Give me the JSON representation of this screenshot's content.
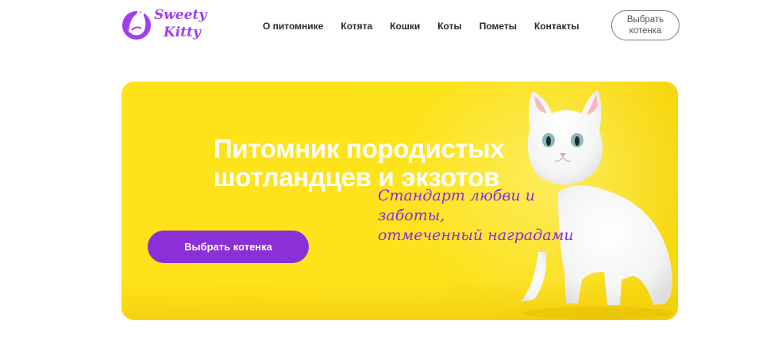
{
  "header": {
    "logo": {
      "line1": "Sweety",
      "line2": "Kitty"
    },
    "nav": [
      "О питомнике",
      "Котята",
      "Кошки",
      "Коты",
      "Пометы",
      "Контакты"
    ],
    "cta_label": "Выбрать котенка"
  },
  "hero": {
    "title_line1": "Питомник породистых",
    "title_line2": "шотландцев и экзотов",
    "subtitle_line1": "Стандарт любви и заботы,",
    "subtitle_line2": "отмеченный наградами",
    "button_label": "Выбрать котенка"
  },
  "colors": {
    "brand_purple": "#8b2fd6",
    "hero_yellow": "#ffe219",
    "hero_title": "#ffffff",
    "subtitle_purple": "#8a2be2"
  }
}
